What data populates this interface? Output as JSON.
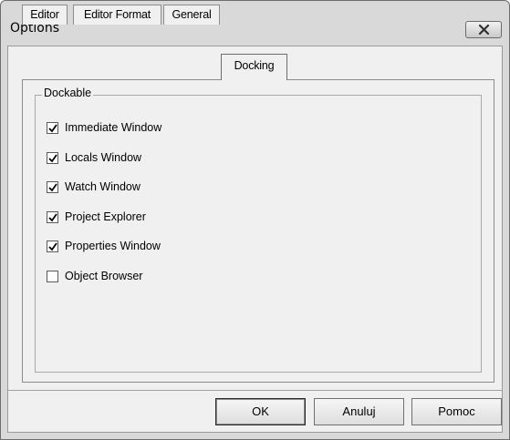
{
  "window": {
    "title": "Options"
  },
  "tabs": [
    {
      "label": "Editor",
      "active": false
    },
    {
      "label": "Editor Format",
      "active": false
    },
    {
      "label": "General",
      "active": false
    },
    {
      "label": "Docking",
      "active": true
    }
  ],
  "dockable": {
    "group_title": "Dockable",
    "items": [
      {
        "label": "Immediate Window",
        "checked": true
      },
      {
        "label": "Locals Window",
        "checked": true
      },
      {
        "label": "Watch Window",
        "checked": true
      },
      {
        "label": "Project Explorer",
        "checked": true
      },
      {
        "label": "Properties Window",
        "checked": true
      },
      {
        "label": "Object Browser",
        "checked": false
      }
    ]
  },
  "buttons": {
    "ok": "OK",
    "cancel": "Anuluj",
    "help": "Pomoc"
  }
}
